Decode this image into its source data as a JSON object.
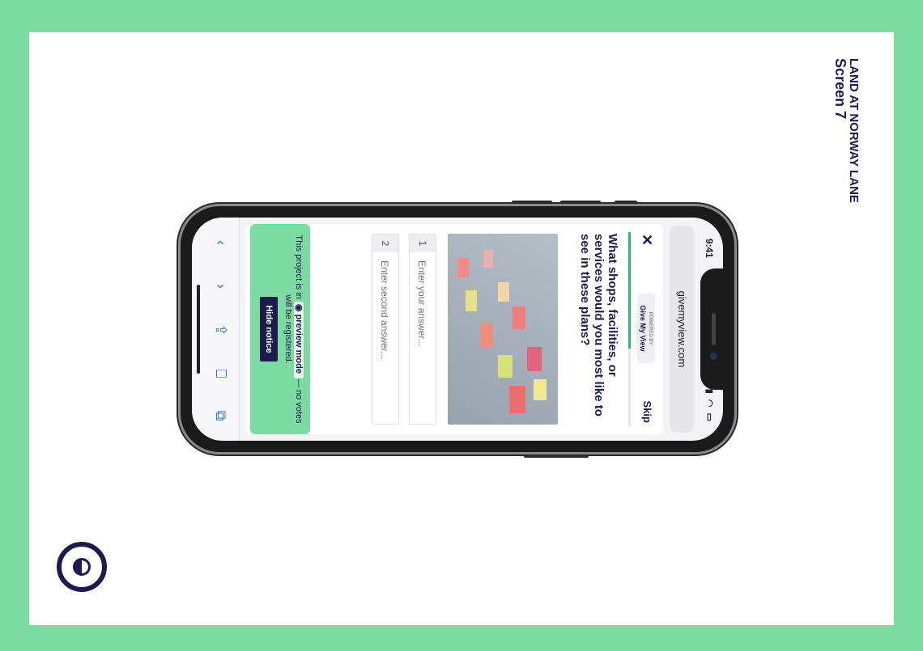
{
  "page": {
    "title_line1": "LAND AT NORWAY LANE",
    "title_line2": "Screen 7",
    "logo_icon": "half-circle-logo-icon"
  },
  "phone": {
    "status_time": "9:41",
    "status_icons": "signal wifi battery",
    "url": "givemyview.com"
  },
  "survey": {
    "close_label": "✕",
    "powered_by": "POWERED BY",
    "brand": "Give My View",
    "skip_label": "Skip",
    "progress": 0.6,
    "question": "What shops, facilities, or services would you most like to see in these plans?",
    "image_desc_icon": "sticky-notes-photo",
    "answers": [
      {
        "num": "1",
        "placeholder": "Enter your answer..."
      },
      {
        "num": "2",
        "placeholder": "Enter second answer..."
      }
    ]
  },
  "notice": {
    "text_before": "This project is in",
    "preview_icon": "eye-icon",
    "preview_label": "preview mode",
    "text_after": "— no votes will be registered.",
    "hide_label": "Hide notice"
  },
  "toolbar": {
    "back": "‹",
    "forward": "›",
    "share": "⇪",
    "bookmarks": "⎕",
    "tabs": "⧉"
  },
  "colors": {
    "background": "#7bdba0",
    "navy": "#1d1a4e",
    "progress": "#3cb371",
    "link_blue": "#2f7bd9"
  }
}
